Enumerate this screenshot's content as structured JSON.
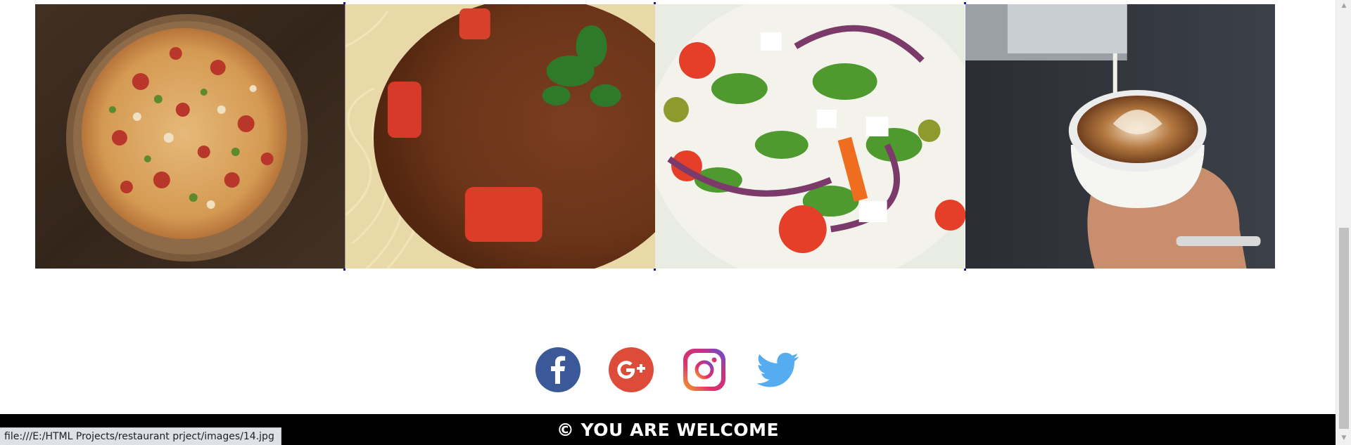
{
  "gallery": {
    "images": [
      {
        "alt": "Pizza",
        "icon": "pizza-photo"
      },
      {
        "alt": "Spaghetti bolognese",
        "icon": "pasta-photo"
      },
      {
        "alt": "Fresh salad",
        "icon": "salad-photo"
      },
      {
        "alt": "Latte art coffee",
        "icon": "coffee-photo"
      }
    ]
  },
  "social": [
    {
      "name": "facebook",
      "icon": "facebook-icon",
      "color": "#3b5998"
    },
    {
      "name": "google-plus",
      "icon": "google-plus-icon",
      "color": "#dd4b39"
    },
    {
      "name": "instagram",
      "icon": "instagram-icon",
      "color": "#c13584"
    },
    {
      "name": "twitter",
      "icon": "twitter-icon",
      "color": "#55acee"
    }
  ],
  "footer": {
    "text": "© YOU ARE WELCOME"
  },
  "status_bar": {
    "url": "file:///E:/HTML Projects/restaurant prject/images/14.jpg"
  },
  "colors": {
    "footer_bg": "#000000",
    "footer_text": "#ffffff",
    "link_underline": "#1a1aa6"
  }
}
